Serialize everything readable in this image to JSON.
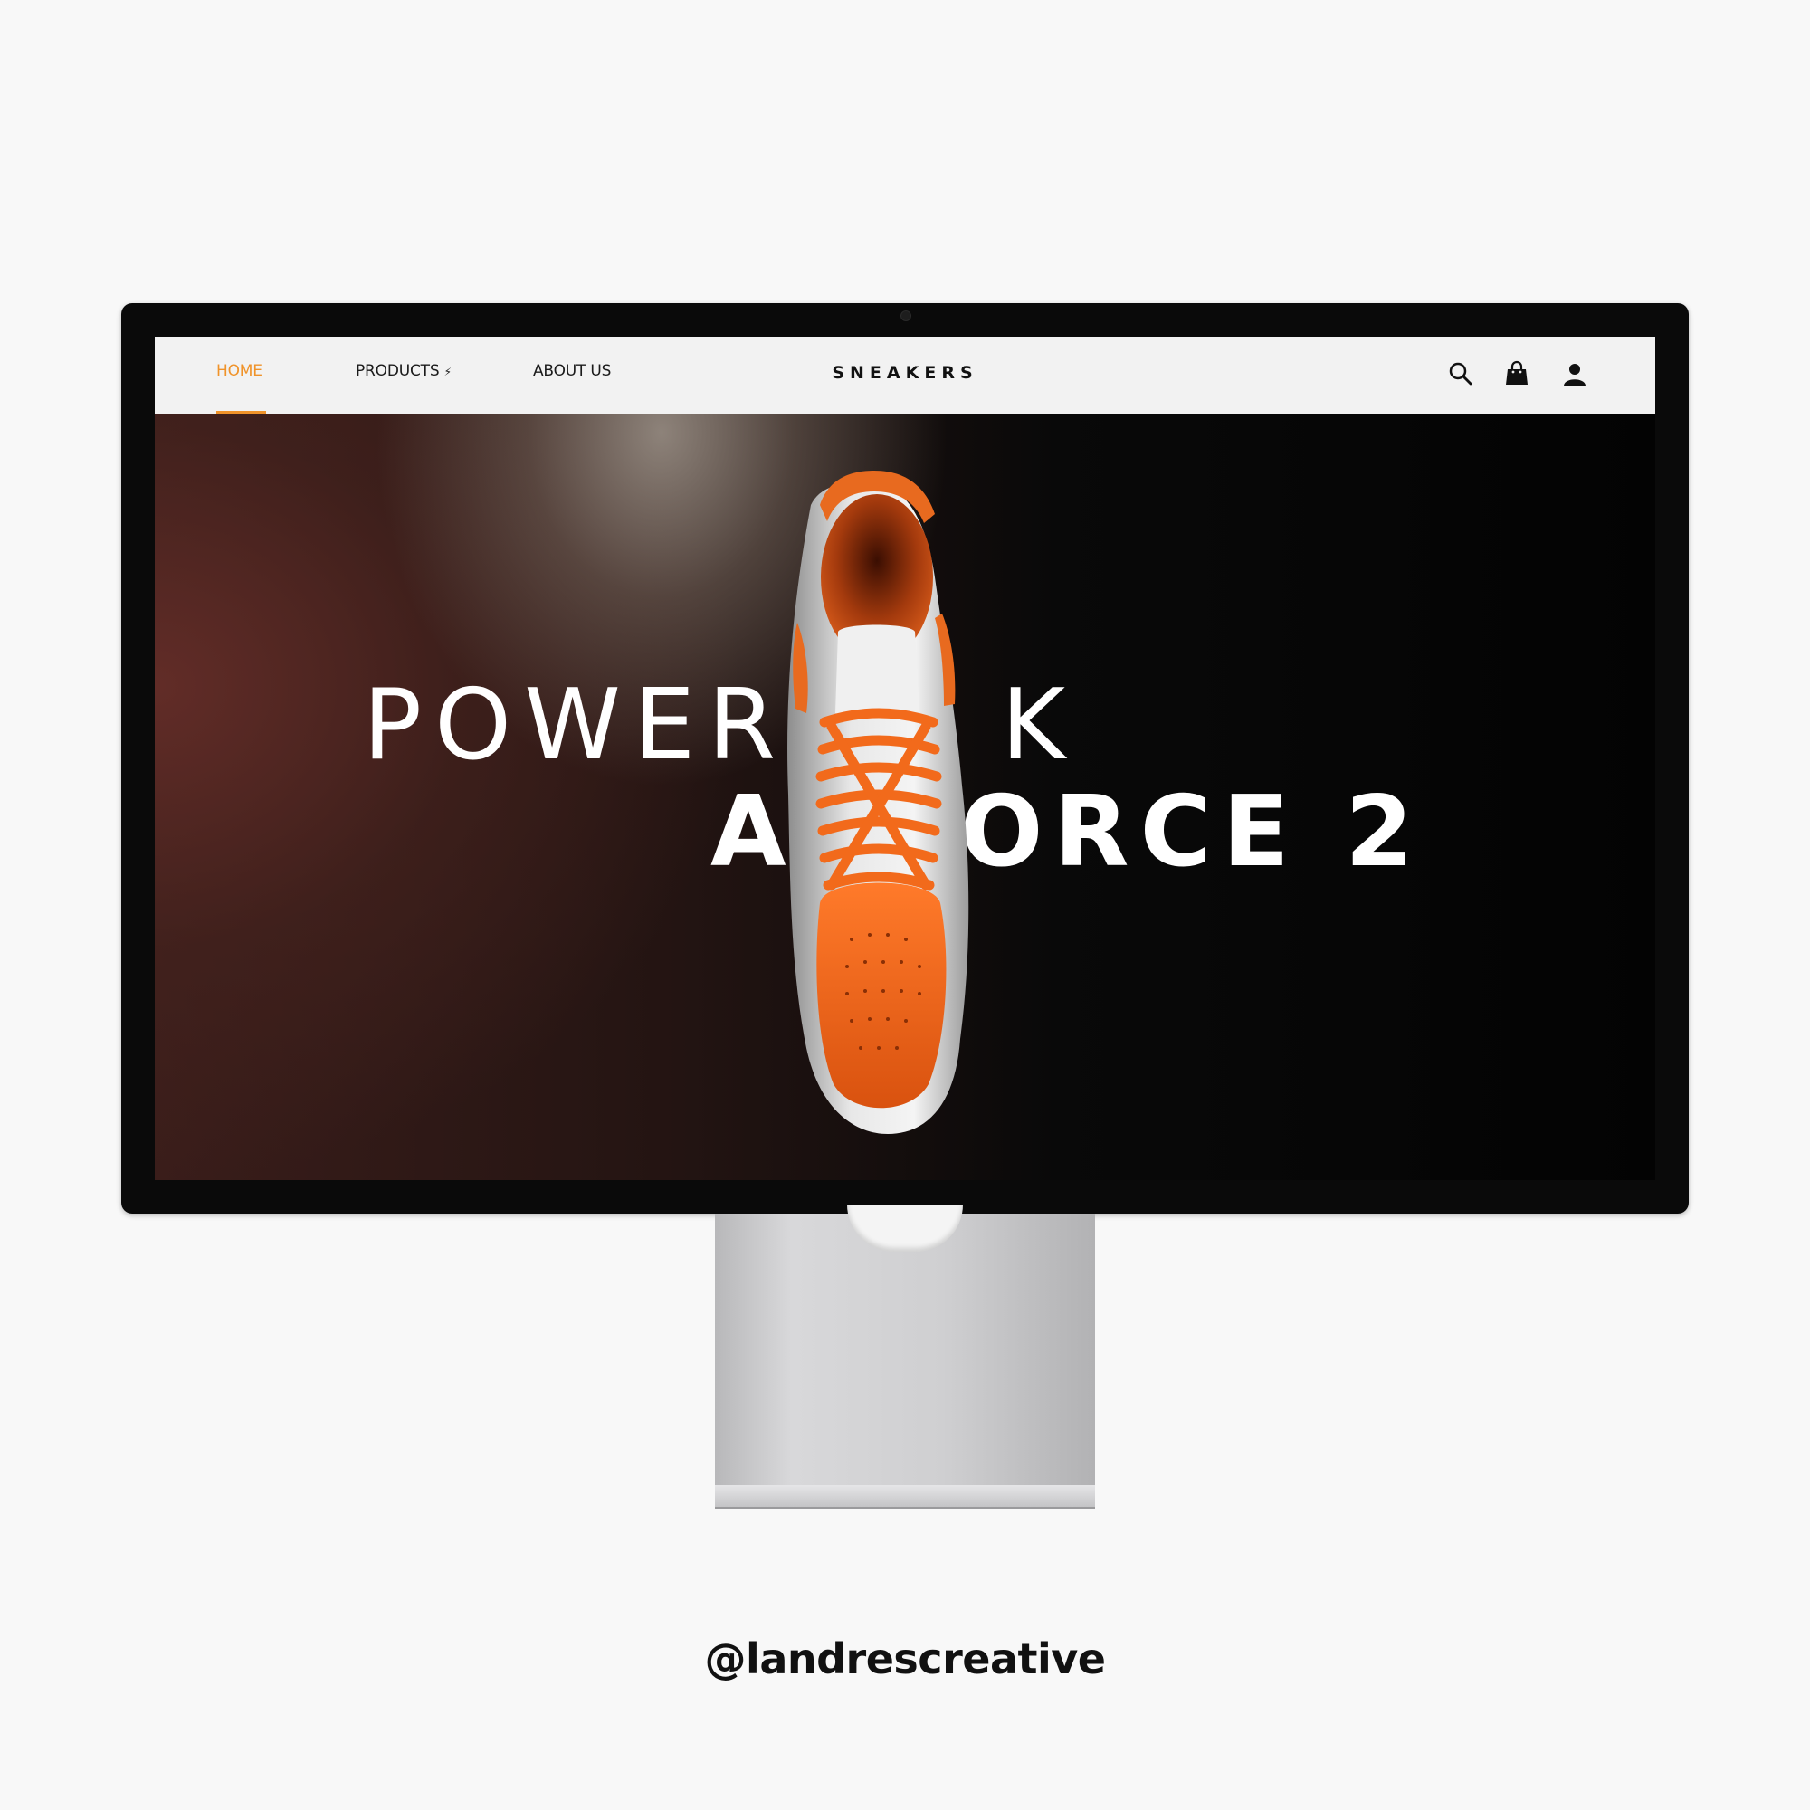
{
  "nav": {
    "items": [
      {
        "label": "HOME",
        "active": true
      },
      {
        "label": "PRODUCTS",
        "suffix": "⚡"
      },
      {
        "label": "ABOUT US"
      }
    ],
    "brand": "SNEAKERS",
    "icons": [
      "search-icon",
      "shopping-bag-icon",
      "user-icon"
    ],
    "active_color": "#f0932a"
  },
  "hero": {
    "line1_left": "POWER",
    "line1_right": "K",
    "line2_left": "A",
    "line2_right": "ORCE 2",
    "accent_color": "#f26a1b"
  },
  "watermark": {
    "handle": "@landrescreative"
  }
}
